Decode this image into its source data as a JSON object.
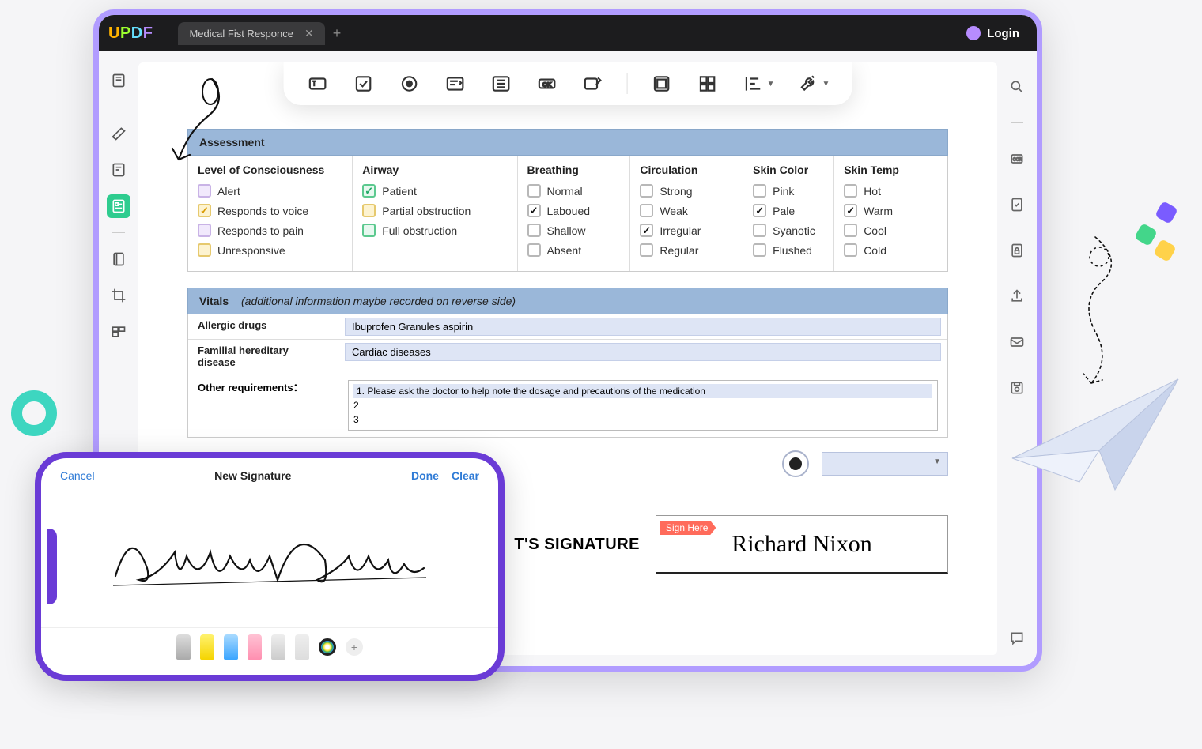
{
  "header": {
    "tab_title": "Medical Fist Responce",
    "login_label": "Login"
  },
  "toolbar": {
    "items": [
      "text-field",
      "checkbox",
      "radio",
      "dropdown",
      "list-box",
      "button",
      "signature",
      "image-field",
      "grid",
      "align",
      "tools"
    ]
  },
  "assessment": {
    "title": "Assessment",
    "columns": [
      {
        "header": "Level of Consciousness",
        "style": "color",
        "options": [
          {
            "label": "Alert",
            "color": "purple",
            "checked": false
          },
          {
            "label": "Responds to voice",
            "color": "yellow",
            "checked": true
          },
          {
            "label": "Responds to pain",
            "color": "purple",
            "checked": false
          },
          {
            "label": "Unresponsive",
            "color": "yellow",
            "checked": false
          }
        ]
      },
      {
        "header": "Airway",
        "style": "color",
        "options": [
          {
            "label": "Patient",
            "color": "green",
            "checked": true
          },
          {
            "label": "Partial obstruction",
            "color": "yellow",
            "checked": false
          },
          {
            "label": "Full obstruction",
            "color": "green",
            "checked": false
          }
        ]
      },
      {
        "header": "Breathing",
        "style": "plain",
        "options": [
          {
            "label": "Normal",
            "checked": false
          },
          {
            "label": "Laboued",
            "checked": true
          },
          {
            "label": "Shallow",
            "checked": false
          },
          {
            "label": "Absent",
            "checked": false
          }
        ]
      },
      {
        "header": "Circulation",
        "style": "plain",
        "options": [
          {
            "label": "Strong",
            "checked": false
          },
          {
            "label": "Weak",
            "checked": false
          },
          {
            "label": "Irregular",
            "checked": true
          },
          {
            "label": "Regular",
            "checked": false
          }
        ]
      },
      {
        "header": "Skin Color",
        "style": "plain",
        "options": [
          {
            "label": "Pink",
            "checked": false
          },
          {
            "label": "Pale",
            "checked": true
          },
          {
            "label": "Syanotic",
            "checked": false
          },
          {
            "label": "Flushed",
            "checked": false
          }
        ]
      },
      {
        "header": "Skin Temp",
        "style": "plain",
        "options": [
          {
            "label": "Hot",
            "checked": false
          },
          {
            "label": "Warm",
            "checked": true
          },
          {
            "label": "Cool",
            "checked": false
          },
          {
            "label": "Cold",
            "checked": false
          }
        ]
      }
    ]
  },
  "vitals": {
    "title": "Vitals",
    "note": "(additional information maybe recorded on reverse side)",
    "rows": [
      {
        "label": "Allergic drugs",
        "value": "Ibuprofen Granules  aspirin"
      },
      {
        "label": "Familial hereditary disease",
        "value": "Cardiac diseases"
      }
    ],
    "other_label": "Other requirements：",
    "other_lines": [
      "1. Please ask the doctor to help note the dosage and precautions of the medication",
      "2",
      "3"
    ]
  },
  "signature": {
    "label": "T'S SIGNATURE",
    "sign_here": "Sign Here",
    "name": "Richard Nixon"
  },
  "phone": {
    "cancel": "Cancel",
    "title": "New Signature",
    "done": "Done",
    "clear": "Clear"
  }
}
